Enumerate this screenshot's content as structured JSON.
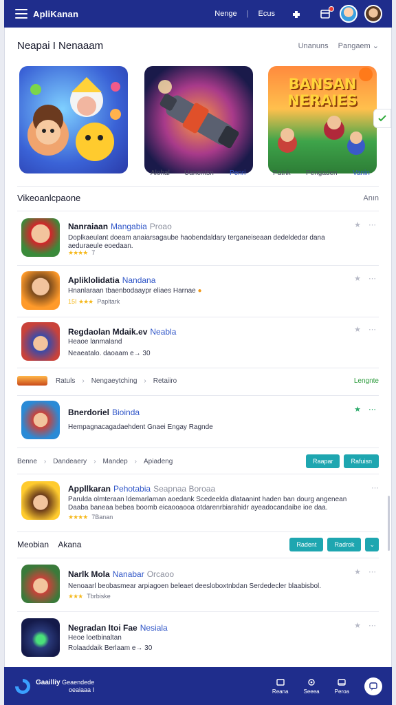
{
  "topbar": {
    "brand": "ApliKanan",
    "nav": [
      "Nenge",
      "Ecus"
    ],
    "icons": [
      "menu-icon",
      "puzzle-icon",
      "calendar-icon",
      "avatar",
      "profile-avatar"
    ]
  },
  "featured": {
    "title": "Neapai I Nenaaam",
    "right_1": "Unanuns",
    "right_2": "Pangaem",
    "captions_1": [
      "Alohal",
      "Uanentsn",
      "Penri"
    ],
    "captions_3": [
      "Patnk",
      "Pengaden",
      "Vanin"
    ],
    "game3_banner_1": "BANSAN",
    "game3_banner_2": "NERAIES"
  },
  "list_section": {
    "title": "Vikeoanlcpaone",
    "right": "Anın"
  },
  "items": [
    {
      "title": "Nanraiaan",
      "tag": "Mangabia",
      "muted": "Proao",
      "desc": "Doplkaeulant doeam anaiarsagaube haobendaldary terganeiseaan dedeldedar dana aeduraeule eoedaan.",
      "rating": "★★★★",
      "meta": "7"
    },
    {
      "title": "Apliklolidatia",
      "tag": "Nandana",
      "desc": "Hnanlaraan tbaenbodaaypr eliaes Harnae",
      "rating_prefix": "15I",
      "rating": "★★★",
      "meta": "Papltark"
    },
    {
      "title": "Regdaolan Mdaik.ev",
      "tag": "Neabla",
      "desc": "Heaoe lanmaland",
      "meta": "Neaeatalo.  daoaam  e→ 30"
    },
    {
      "title": "Bnerdoriel",
      "tag": "Bioinda",
      "desc": "Hempagnacagadaehdent Gnaei Engay  Ragnde"
    },
    {
      "title": "Appllkaran",
      "tag": "Pehotabia",
      "muted": "Seapnaa  Boroaa",
      "desc": "Parulda olmteraan ldemarlaman aoedank Scedeelda dlataanint haden ban dourg angenean Daaba baneaa bebea boomb eicaooaooa otdarenrbiarahidr ayeadocandaibe ioe daa.",
      "rating": "★★★★",
      "meta": "7Banan"
    },
    {
      "title": "Narlk Mola",
      "tag": "Nanabar",
      "muted": "Orcaoo",
      "desc": "Nenoaarl beobasmear arpiagoen beleaet deesloboxtnbdan Serdedecler blaabisbol.",
      "rating": "★★★",
      "meta": "Tbrbiske"
    },
    {
      "title": "Negradan Itoi Fae",
      "tag": "Nesiala",
      "desc": "Heoe loetbinaltan",
      "meta": "Rolaaddaik  Berlaam e→ 30"
    }
  ],
  "breadcrumb_1": {
    "items": [
      "Ratuls",
      "Nengaeytching",
      "Retaiiro"
    ],
    "action": "Lengnte"
  },
  "breadcrumb_2": {
    "items": [
      "Benne",
      "Dandeaery",
      "Mandep",
      "Apiadeng"
    ],
    "buttons": [
      "Raapar",
      "Rafuisn"
    ]
  },
  "section_3": {
    "title_1": "Meobian",
    "title_2": "Akana",
    "buttons": [
      "Radent",
      "Radrok"
    ]
  },
  "bottombar": {
    "brand": "Gaailliy",
    "sub_1": "Geaendede",
    "sub_2": "oeaiaaa I",
    "nav": [
      "Reana",
      "Seeea",
      "Peroa"
    ]
  },
  "colors": {
    "primary": "#1f2d8c",
    "accent": "#1ea6b0",
    "link": "#2f55c7",
    "star": "#f5b81c"
  }
}
